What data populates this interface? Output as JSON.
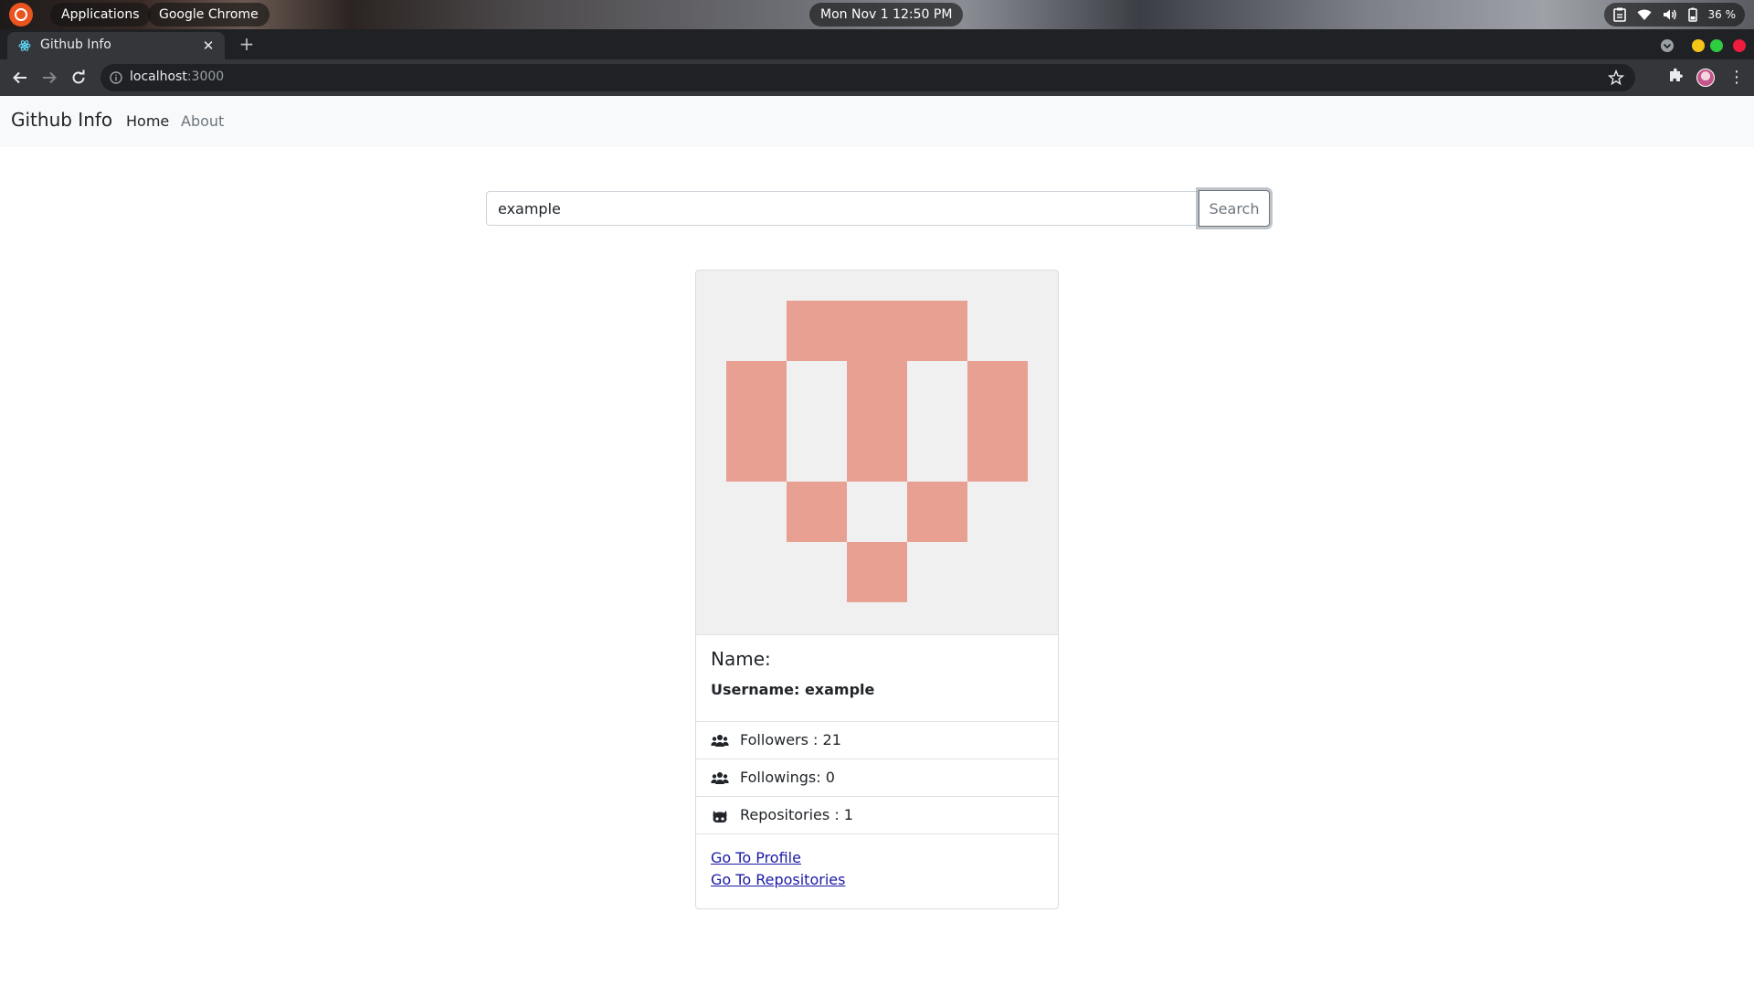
{
  "os_bar": {
    "activities_icon": "ubuntu-logo-icon",
    "applications": "Applications",
    "app_name": "Google Chrome",
    "datetime": "Mon Nov 1  12:50 PM",
    "battery": "36 %"
  },
  "browser": {
    "tab_title": "Github Info",
    "url_host": "localhost",
    "url_port": ":3000"
  },
  "app": {
    "brand": "Github Info",
    "nav": [
      {
        "label": "Home",
        "active": true
      },
      {
        "label": "About",
        "active": false
      }
    ]
  },
  "search": {
    "value": "example",
    "button": "Search"
  },
  "profile": {
    "avatar_color": "#e8a093",
    "avatar_bg": "#f0f0f0",
    "name_label": "Name:",
    "username": "Username: example",
    "stats": [
      {
        "icon": "users-icon",
        "text": "Followers : 21"
      },
      {
        "icon": "users-icon",
        "text": "Followings: 0"
      },
      {
        "icon": "github-icon",
        "text": "Repositories : 1"
      }
    ],
    "links": {
      "profile": "Go To Profile",
      "repositories": "Go To Repositories"
    }
  }
}
